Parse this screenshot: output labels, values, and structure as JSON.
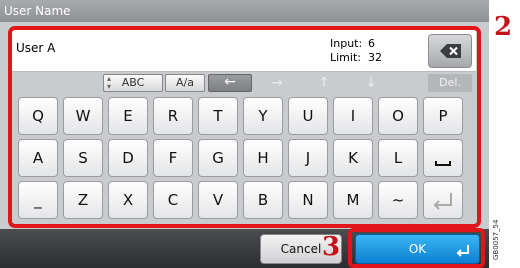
{
  "window": {
    "title": "User Name"
  },
  "field": {
    "value": "User A",
    "input_label": "Input:",
    "input_value": "6",
    "limit_label": "Limit:",
    "limit_value": "32"
  },
  "toolbar": {
    "mode_label": "ABC",
    "case_label": "A/a",
    "del_label": "Del."
  },
  "keyboard": {
    "row1": [
      "Q",
      "W",
      "E",
      "R",
      "T",
      "Y",
      "U",
      "I",
      "O",
      "P"
    ],
    "row2": [
      "A",
      "S",
      "D",
      "F",
      "G",
      "H",
      "J",
      "K",
      "L"
    ],
    "row3": [
      "_",
      "Z",
      "X",
      "C",
      "V",
      "B",
      "N",
      "M",
      "~"
    ]
  },
  "footer": {
    "cancel_label": "Cancel",
    "ok_label": "OK"
  },
  "callouts": {
    "step2": "2",
    "step3": "3"
  },
  "figure_code": "GB0057_54",
  "colors": {
    "callout_red": "#e0161b",
    "ok_blue": "#1a8fe0"
  }
}
